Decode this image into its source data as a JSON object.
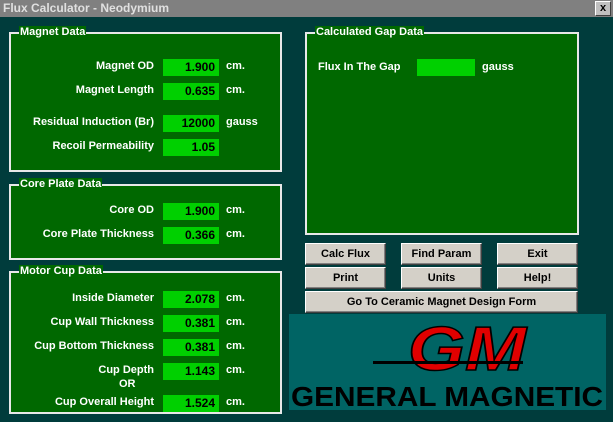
{
  "window": {
    "title": "Flux Calculator - Neodymium",
    "close_label": "x"
  },
  "magnet_data": {
    "legend": "Magnet Data",
    "fields": [
      {
        "label": "Magnet OD",
        "value": "1.900",
        "unit": "cm."
      },
      {
        "label": "Magnet Length",
        "value": "0.635",
        "unit": "cm."
      },
      {
        "label": "Residual Induction (Br)",
        "value": "12000",
        "unit": "gauss"
      },
      {
        "label": "Recoil Permeability",
        "value": "1.05",
        "unit": ""
      }
    ]
  },
  "core_plate_data": {
    "legend": "Core Plate Data",
    "fields": [
      {
        "label": "Core OD",
        "value": "1.900",
        "unit": "cm."
      },
      {
        "label": "Core Plate Thickness",
        "value": "0.366",
        "unit": "cm."
      }
    ]
  },
  "motor_cup_data": {
    "legend": "Motor Cup Data",
    "fields": [
      {
        "label": "Inside Diameter",
        "value": "2.078",
        "unit": "cm."
      },
      {
        "label": "Cup Wall Thickness",
        "value": "0.381",
        "unit": "cm."
      },
      {
        "label": "Cup Bottom Thickness",
        "value": "0.381",
        "unit": "cm."
      },
      {
        "label": "Cup Depth",
        "value": "1.143",
        "unit": "cm."
      },
      {
        "label": "Cup Overall Height",
        "value": "1.524",
        "unit": "cm."
      }
    ],
    "or_label": "OR"
  },
  "gap_data": {
    "legend": "Calculated Gap Data",
    "flux_label": "Flux In The Gap",
    "flux_value": "",
    "flux_unit": "gauss"
  },
  "buttons": {
    "calc_flux": "Calc Flux",
    "find_param": "Find Param",
    "exit": "Exit",
    "print": "Print",
    "units": "Units",
    "help": "Help!",
    "ceramic": "Go To Ceramic Magnet Design Form"
  },
  "logo": {
    "monogram": "GM",
    "text": "GENERAL MAGNETIC"
  },
  "colors": {
    "panel": "#006800",
    "field": "#00d000",
    "background": "#003c3c",
    "logo_bg": "#006464",
    "logo_red": "#e00000"
  }
}
